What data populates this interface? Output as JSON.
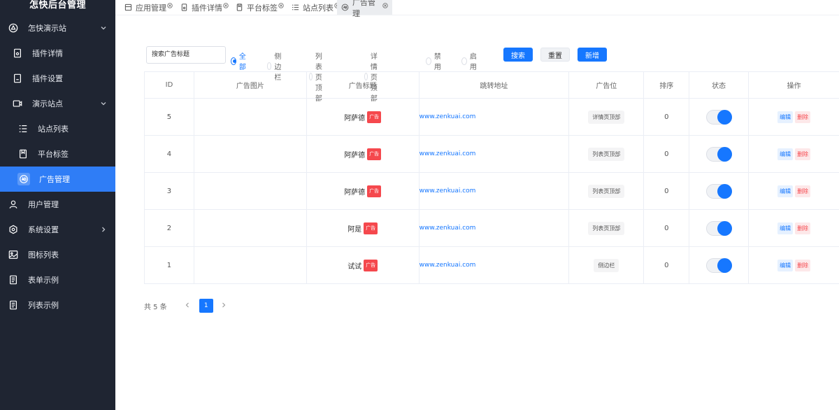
{
  "sidebar": {
    "brand": "怎快后台管理",
    "items": [
      {
        "label": "怎快演示站",
        "icon": "triangle-icon"
      },
      {
        "label": "插件详情",
        "icon": "doc-icon"
      },
      {
        "label": "插件设置",
        "icon": "doc-gear-icon"
      },
      {
        "label": "演示站点",
        "icon": "video-icon"
      },
      {
        "label": "站点列表",
        "icon": "list-icon"
      },
      {
        "label": "平台标签",
        "icon": "bookmark-icon"
      },
      {
        "label": "广告管理",
        "icon": "ad-icon"
      },
      {
        "label": "用户管理",
        "icon": "user-icon"
      },
      {
        "label": "系统设置",
        "icon": "gear-icon"
      },
      {
        "label": "图标列表",
        "icon": "image-icon"
      },
      {
        "label": "表单示例",
        "icon": "form-icon"
      },
      {
        "label": "列表示例",
        "icon": "form-icon"
      }
    ]
  },
  "tabs": [
    {
      "label": "应用管理"
    },
    {
      "label": "插件详情"
    },
    {
      "label": "平台标签"
    },
    {
      "label": "站点列表"
    },
    {
      "label": "广告管理"
    }
  ],
  "toolbar": {
    "search_value": "搜索广告标题",
    "radios": [
      "全部",
      "侧边栏",
      "列表页顶部",
      "详情页顶部",
      "禁用",
      "启用"
    ],
    "selected_radio": "全部",
    "search_button": "搜索",
    "reset_button": "重置",
    "add_button": "新增"
  },
  "table": {
    "headers": {
      "id": "ID",
      "image": "广告图片",
      "title": "广告标题",
      "url": "跳转地址",
      "position": "广告位",
      "sort": "排序",
      "status": "状态",
      "ops": "操作"
    },
    "badge": "广告",
    "edit_label": "编辑",
    "delete_label": "删除",
    "rows": [
      {
        "id": "5",
        "title": "阿萨德",
        "url": "www.zenkuai.com",
        "position": "详情页顶部",
        "sort": "0",
        "status": "on"
      },
      {
        "id": "4",
        "title": "阿萨德",
        "url": "www.zenkuai.com",
        "position": "列表页顶部",
        "sort": "0",
        "status": "on"
      },
      {
        "id": "3",
        "title": "阿萨德",
        "url": "www.zenkuai.com",
        "position": "列表页顶部",
        "sort": "0",
        "status": "on"
      },
      {
        "id": "2",
        "title": "阿是",
        "url": "www.zenkuai.com",
        "position": "列表页顶部",
        "sort": "0",
        "status": "on"
      },
      {
        "id": "1",
        "title": "试试",
        "url": "www.zenkuai.com",
        "position": "侧边栏",
        "sort": "0",
        "status": "on"
      }
    ]
  },
  "pagination": {
    "total_text": "共 5 条",
    "current_page": "1"
  },
  "colors": {
    "sidebar_bg": "#1f2532",
    "accent": "#1677ff",
    "active_menu": "#2f7df6",
    "danger": "#f5484d"
  }
}
